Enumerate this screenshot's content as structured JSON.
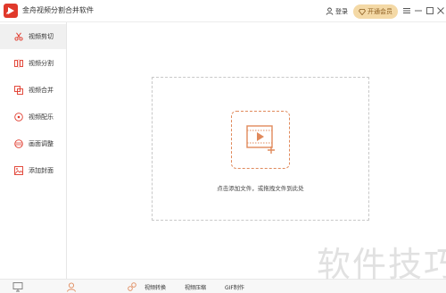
{
  "app": {
    "title": "金舟视频分割合并软件",
    "accent_color": "#e0392b",
    "logo_icon": "play-logo-icon"
  },
  "header": {
    "login_label": "登录",
    "login_icon": "user-icon",
    "vip_label": "开通会员",
    "vip_icon": "diamond-icon",
    "vip_color": "#f4d9a6",
    "controls": [
      "menu-icon",
      "minimize-icon",
      "maximize-icon",
      "close-icon"
    ]
  },
  "sidebar": {
    "items": [
      {
        "label": "视频剪切",
        "icon": "scissors-icon",
        "active": true
      },
      {
        "label": "视频分割",
        "icon": "split-icon",
        "active": false
      },
      {
        "label": "视频合并",
        "icon": "merge-icon",
        "active": false
      },
      {
        "label": "视频配乐",
        "icon": "music-icon",
        "active": false
      },
      {
        "label": "画面调整",
        "icon": "adjust-icon",
        "active": false
      },
      {
        "label": "添加封面",
        "icon": "image-icon",
        "active": false
      }
    ]
  },
  "main": {
    "drop_hint": "点击添加文件，或拖拽文件到此处",
    "add_icon": "add-video-icon",
    "icon_color": "#e08a5c"
  },
  "bottom": {
    "left_icons": [
      "monitor-icon",
      "support-icon"
    ],
    "links": [
      {
        "label": "视频转换",
        "icon": "link-icon"
      },
      {
        "label": "视频压缩"
      },
      {
        "label": "GIF制作"
      }
    ]
  },
  "watermark": "软件技巧"
}
